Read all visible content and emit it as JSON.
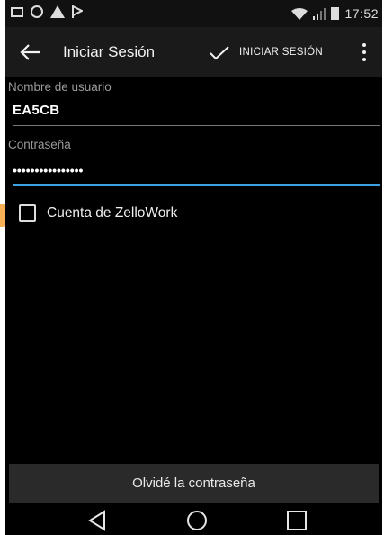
{
  "status_bar": {
    "time": "17:52",
    "left_icons": [
      "screen-icon",
      "circle-icon",
      "warning-icon",
      "flag-icon"
    ],
    "right_icons": [
      "wifi-icon",
      "signal-icon",
      "battery-icon"
    ]
  },
  "action_bar": {
    "title": "Iniciar Sesión",
    "confirm_label": "INICIAR SESIÓN",
    "back_icon": "arrow-left-icon",
    "confirm_icon": "check-icon",
    "overflow_icon": "more-vert-icon"
  },
  "form": {
    "username_label": "Nombre de usuario",
    "username_value": "EA5CB",
    "password_label": "Contraseña",
    "password_value": "••••••••••••••••",
    "zellowork_checkbox_label": "Cuenta de ZelloWork",
    "zellowork_checked": false
  },
  "footer": {
    "forgot_password_label": "Olvidé la contraseña"
  },
  "nav_bar": {
    "icons": [
      "back-triangle-icon",
      "home-circle-icon",
      "recents-square-icon"
    ]
  },
  "colors": {
    "accent": "#3fa2e0",
    "background": "#000000",
    "decoration": "#f7a23a"
  }
}
